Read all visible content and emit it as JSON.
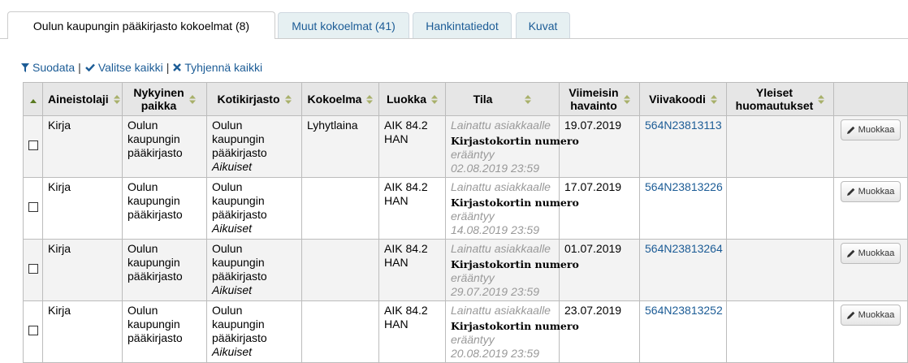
{
  "tabs": [
    {
      "label": "Oulun kaupungin pääkirjasto kokoelmat (8)",
      "active": true
    },
    {
      "label": "Muut kokoelmat (41)",
      "active": false
    },
    {
      "label": "Hankintatiedot",
      "active": false
    },
    {
      "label": "Kuvat",
      "active": false
    }
  ],
  "filters": {
    "filter_label": "Suodata",
    "select_all_label": "Valitse kaikki",
    "clear_all_label": "Tyhjennä kaikki",
    "separator": "|"
  },
  "table": {
    "headers": {
      "item_type": "Aineistolaji",
      "current_location_1": "Nykyinen",
      "current_location_2": "paikka",
      "home_library": "Kotikirjasto",
      "collection": "Kokoelma",
      "call_number": "Luokka",
      "status": "Tila",
      "last_seen_1": "Viimeisin",
      "last_seen_2": "havainto",
      "barcode": "Viivakoodi",
      "public_notes_1": "Yleiset",
      "public_notes_2": "huomautukset"
    },
    "rows": [
      {
        "item_type": "Kirja",
        "current_location": "Oulun kaupungin pääkirjasto",
        "home_library": "Oulun kaupungin pääkirjasto",
        "home_sub": "Aikuiset",
        "collection": "Lyhytlaina",
        "call_number": "AIK 84.2 HAN",
        "status_main": "Lainattu asiakkaalle",
        "status_card": "Kirjastokortin numero",
        "status_due_label": "erääntyy",
        "status_due": "02.08.2019 23:59",
        "last_seen": "19.07.2019",
        "barcode": "564N23813113",
        "notes": "",
        "edit_label": "Muokkaa"
      },
      {
        "item_type": "Kirja",
        "current_location": "Oulun kaupungin pääkirjasto",
        "home_library": "Oulun kaupungin pääkirjasto",
        "home_sub": "Aikuiset",
        "collection": "",
        "call_number": "AIK 84.2 HAN",
        "status_main": "Lainattu asiakkaalle",
        "status_card": "Kirjastokortin numero",
        "status_due_label": "erääntyy",
        "status_due": "14.08.2019 23:59",
        "last_seen": "17.07.2019",
        "barcode": "564N23813226",
        "notes": "",
        "edit_label": "Muokkaa"
      },
      {
        "item_type": "Kirja",
        "current_location": "Oulun kaupungin pääkirjasto",
        "home_library": "Oulun kaupungin pääkirjasto",
        "home_sub": "Aikuiset",
        "collection": "",
        "call_number": "AIK 84.2 HAN",
        "status_main": "Lainattu asiakkaalle",
        "status_card": "Kirjastokortin numero",
        "status_due_label": "erääntyy",
        "status_due": "29.07.2019 23:59",
        "last_seen": "01.07.2019",
        "barcode": "564N23813264",
        "notes": "",
        "edit_label": "Muokkaa"
      },
      {
        "item_type": "Kirja",
        "current_location": "Oulun kaupungin pääkirjasto",
        "home_library": "Oulun kaupungin pääkirjasto",
        "home_sub": "Aikuiset",
        "collection": "",
        "call_number": "AIK 84.2 HAN",
        "status_main": "Lainattu asiakkaalle",
        "status_card": "Kirjastokortin numero",
        "status_due_label": "erääntyy",
        "status_due": "20.08.2019 23:59",
        "last_seen": "23.07.2019",
        "barcode": "564N23813252",
        "notes": "",
        "edit_label": "Muokkaa"
      }
    ]
  },
  "icons": {
    "filter": "filter-icon",
    "check": "check-icon",
    "clear": "times-icon",
    "sort": "sort-icon",
    "edit": "pencil-icon"
  },
  "colors": {
    "link": "#1c5c96",
    "tab_inactive_bg": "#e6f0f2",
    "header_bg": "#e6e6e6",
    "odd_row_bg": "#f3f3f3",
    "muted_text": "#999999"
  }
}
